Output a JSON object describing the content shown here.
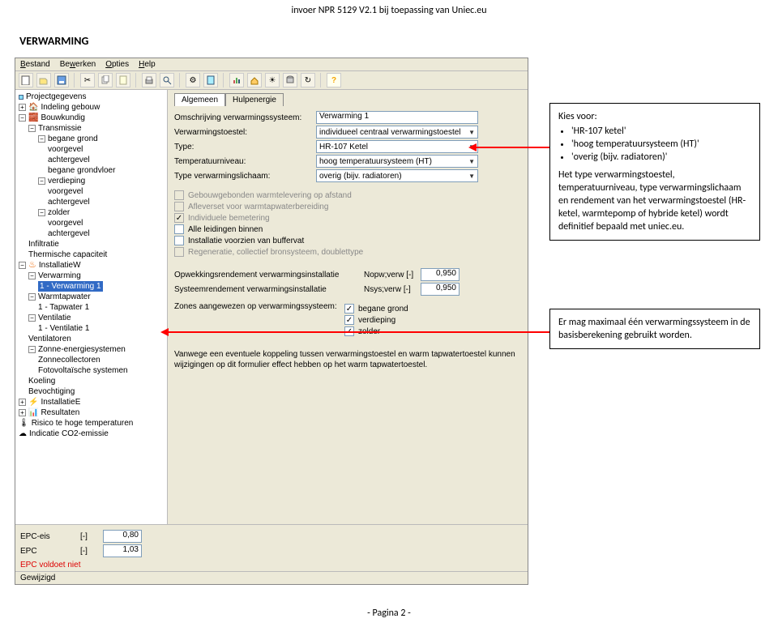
{
  "header": "invoer NPR 5129 V2.1 bij toepassing van Uniec.eu",
  "section": "VERWARMING",
  "menu": {
    "bestand": "Bestand",
    "bewerken": "Bewerken",
    "opties": "Opties",
    "help": "Help"
  },
  "tree": {
    "projectgegevens": "Projectgegevens",
    "indeling": "Indeling gebouw",
    "bouwkundig": "Bouwkundig",
    "transmissie": "Transmissie",
    "begane_grond": "begane grond",
    "voorgevel": "voorgevel",
    "achtergevel": "achtergevel",
    "begane_grondvloer": "begane grondvloer",
    "verdieping": "verdieping",
    "zolder": "zolder",
    "infiltratie": "Infiltratie",
    "thermische": "Thermische capaciteit",
    "installatieW": "InstallatieW",
    "verwarming": "Verwarming",
    "item_sel": "1 - Verwarming 1",
    "warmtapwater": "Warmtapwater",
    "tapwater1": "1 - Tapwater 1",
    "ventilatie": "Ventilatie",
    "ventilatie1": "1 - Ventilatie 1",
    "ventilatoren": "Ventilatoren",
    "zonne": "Zonne-energiesystemen",
    "zonnecol": "Zonnecollectoren",
    "fotov": "Fotovoltaïsche systemen",
    "koeling": "Koeling",
    "bevochtiging": "Bevochtiging",
    "installatieE": "InstallatieE",
    "resultaten": "Resultaten",
    "risico": "Risico te hoge temperaturen",
    "co2": "Indicatie CO2-emissie"
  },
  "tabs": {
    "algemeen": "Algemeen",
    "hulp": "Hulpenergie"
  },
  "fields": {
    "omschrijving_lbl": "Omschrijving verwarmingssysteem:",
    "omschrijving_val": "Verwarming 1",
    "toestel_lbl": "Verwarmingstoestel:",
    "toestel_val": "individueel centraal verwarmingstoestel",
    "type_lbl": "Type:",
    "type_val": "HR-107 Ketel",
    "tempniv_lbl": "Temperatuurniveau:",
    "tempniv_val": "hoog temperatuursysteem (HT)",
    "verwarmlich_lbl": "Type verwarmingslichaam:",
    "verwarmlich_val": "overig (bijv. radiatoren)",
    "chk1": "Gebouwgebonden warmtelevering op afstand",
    "chk2": "Afleverset voor warmtapwaterbereiding",
    "chk3": "Individuele bemetering",
    "chk4": "Alle leidingen binnen",
    "chk5": "Installatie voorzien van buffervat",
    "chk6": "Regeneratie, collectief bronsysteem, doublettype",
    "opw_lbl": "Opwekkingsrendement verwarmingsinstallatie",
    "opw_unit": "Nopw;verw [-]",
    "opw_val": "0,950",
    "sys_lbl": "Systeemrendement verwarmingsinstallatie",
    "sys_unit": "Nsys;verw [-]",
    "sys_val": "0,950",
    "zones_lbl": "Zones aangewezen op verwarmingssysteem:",
    "zone1": "begane grond",
    "zone2": "verdieping",
    "zone3": "zolder",
    "note": "Vanwege een eventuele koppeling tussen verwarmingstoestel en warm tapwatertoestel kunnen wijzigingen op dit formulier effect hebben op het warm tapwatertoestel."
  },
  "bottom": {
    "epceis_lbl": "EPC-eis",
    "epceis_unit": "[-]",
    "epceis_val": "0,80",
    "epc_lbl": "EPC",
    "epc_unit": "[-]",
    "epc_val": "1,03",
    "voldoet": "EPC voldoet niet"
  },
  "status": "Gewijzigd",
  "callout1": {
    "kies": "Kies voor:",
    "b1": "'HR-107 ketel'",
    "b2": "'hoog temperatuursysteem (HT)'",
    "b3": "'overig (bijv. radiatoren)'",
    "p": "Het type verwarmingstoestel, temperatuurniveau, type verwarmingslichaam en rendement van het verwarmingstoestel (HR-ketel, warmtepomp of hybride ketel) wordt definitief bepaald met uniec.eu."
  },
  "callout2": "Er mag maximaal één verwarmingssysteem in de basisberekening gebruikt worden.",
  "footer": "- Pagina 2 -"
}
